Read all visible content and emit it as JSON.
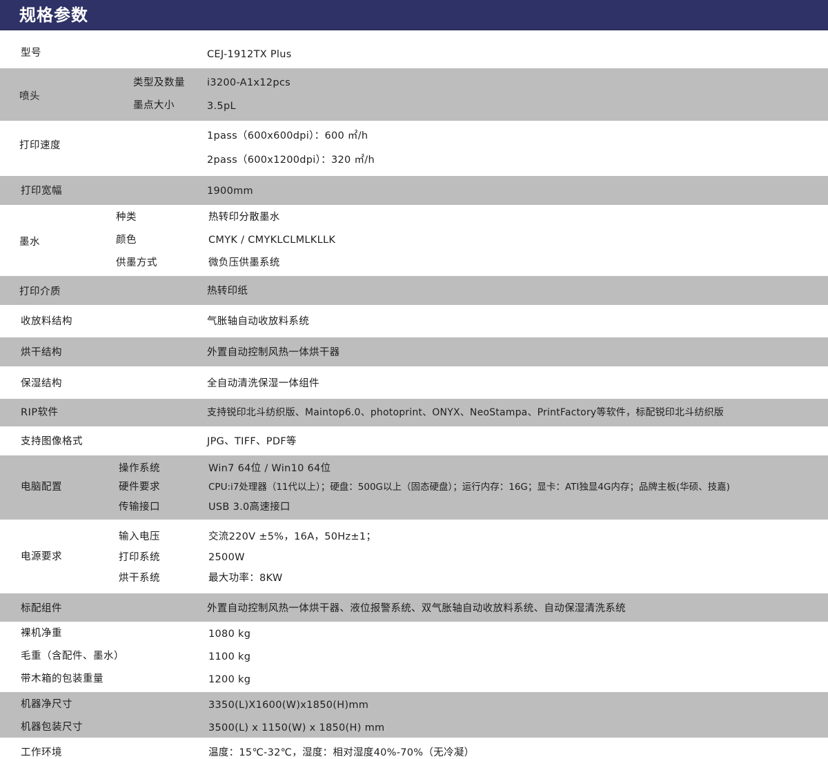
{
  "header": {
    "title": "规格参数"
  },
  "rows": {
    "model": {
      "label": "型号",
      "value": "CEJ-1912TX Plus"
    },
    "nozzle": {
      "label": "喷头",
      "sub": [
        {
          "label": "类型及数量",
          "value": "i3200-A1x12pcs"
        },
        {
          "label": "墨点大小",
          "value": "3.5pL"
        }
      ]
    },
    "speed": {
      "label": "打印速度",
      "values": [
        "1pass（600x600dpi）：600 ㎡/h",
        "2pass（600x1200dpi）：320 ㎡/h"
      ]
    },
    "width": {
      "label": "打印宽幅",
      "value": "1900mm"
    },
    "ink": {
      "label": "墨水",
      "sub": [
        {
          "label": "种类",
          "value": "热转印分散墨水"
        },
        {
          "label": "颜色",
          "value": "CMYK  /  CMYKLCLMLKLLK"
        },
        {
          "label": "供墨方式",
          "value": "微负压供墨系统"
        }
      ]
    },
    "media": {
      "label": "打印介质",
      "value": "热转印纸"
    },
    "winding": {
      "label": "收放料结构",
      "value": "气胀轴自动收放料系统"
    },
    "drying": {
      "label": "烘干结构",
      "value": "外置自动控制风热一体烘干器"
    },
    "moisture": {
      "label": "保湿结构",
      "value": "全自动清洗保湿一体组件"
    },
    "rip": {
      "label": "RIP软件",
      "value": "支持锐印北斗纺织版、Maintop6.0、photoprint、ONYX、NeoStampa、PrintFactory等软件，标配锐印北斗纺织版"
    },
    "formats": {
      "label": "支持图像格式",
      "value": "JPG、TIFF、PDF等"
    },
    "computer": {
      "label": "电脑配置",
      "sub": [
        {
          "label": "操作系统",
          "value": "Win7 64位 / Win10 64位"
        },
        {
          "label": "硬件要求",
          "value": "CPU:i7处理器（11代以上）；硬盘：500G以上（固态硬盘）；运行内存：16G；显卡：ATI独显4G内存；品牌主板(华硕、技嘉)"
        },
        {
          "label": "传输接口",
          "value": "USB 3.0高速接口"
        }
      ]
    },
    "power": {
      "label": "电源要求",
      "sub": [
        {
          "label": "输入电压",
          "value": "交流220V ±5%，16A，50Hz±1；"
        },
        {
          "label": "打印系统",
          "value": "2500W"
        },
        {
          "label": "烘干系统",
          "value": "最大功率：8KW"
        }
      ]
    },
    "standard": {
      "label": "标配组件",
      "value": "外置自动控制风热一体烘干器、液位报警系统、双气胀轴自动收放料系统、自动保湿清洗系统"
    },
    "net_weight": {
      "label": "裸机净重",
      "value": "1080 kg"
    },
    "gross_weight": {
      "label": "毛重（含配件、墨水）",
      "value": "1100 kg"
    },
    "crate_weight": {
      "label": "带木箱的包装重量",
      "value": "1200 kg"
    },
    "net_size": {
      "label": "机器净尺寸",
      "value": "3350(L)X1600(W)x1850(H)mm"
    },
    "pack_size": {
      "label": "机器包装尺寸",
      "value": "3500(L) x 1150(W) x 1850(H) mm"
    },
    "environment": {
      "label": "工作环境",
      "value": "温度：15℃-32℃，湿度：相对湿度40%-70%（无冷凝）"
    }
  }
}
